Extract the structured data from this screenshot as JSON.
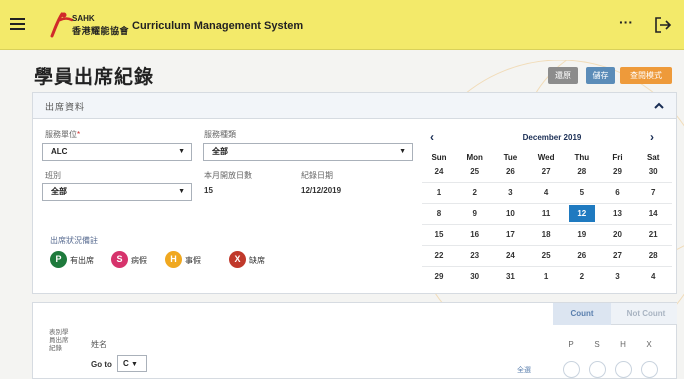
{
  "app": {
    "title": "Curriculum Management System",
    "logo_abbr": "SAHK",
    "logo_cn": "香港耀能協會",
    "more_label": "···"
  },
  "page": {
    "title": "學員出席紀錄",
    "actions": {
      "cancel": "還原",
      "save": "儲存",
      "view": "查閱模式"
    }
  },
  "attendance": {
    "panel_title": "出席資料",
    "service_unit": {
      "label": "服務單位",
      "required_mark": "*",
      "value": "ALC"
    },
    "service_type": {
      "label": "服務種類",
      "value": "全部"
    },
    "class": {
      "label": "班別",
      "value": "全部"
    },
    "open_days": {
      "label": "本月開放日數",
      "value": "15"
    },
    "record_date": {
      "label": "紀錄日期",
      "value": "12/12/2019"
    },
    "legend": {
      "title": "出席狀況備註",
      "items": [
        {
          "letter": "P",
          "label": "有出席",
          "color": "#1e7a3c"
        },
        {
          "letter": "S",
          "label": "病假",
          "color": "#d6336c"
        },
        {
          "letter": "H",
          "label": "事假",
          "color": "#f0a820"
        },
        {
          "letter": "X",
          "label": "缺席",
          "color": "#c0392b"
        }
      ]
    }
  },
  "calendar": {
    "month_label": "December 2019",
    "weekdays": [
      "Sun",
      "Mon",
      "Tue",
      "Wed",
      "Thu",
      "Fri",
      "Sat"
    ],
    "weeks": [
      [
        "24",
        "25",
        "26",
        "27",
        "28",
        "29",
        "30"
      ],
      [
        "1",
        "2",
        "3",
        "4",
        "5",
        "6",
        "7"
      ],
      [
        "8",
        "9",
        "10",
        "11",
        "12",
        "13",
        "14"
      ],
      [
        "15",
        "16",
        "17",
        "18",
        "19",
        "20",
        "21"
      ],
      [
        "22",
        "23",
        "24",
        "25",
        "26",
        "27",
        "28"
      ],
      [
        "29",
        "30",
        "31",
        "1",
        "2",
        "3",
        "4"
      ]
    ],
    "selected_day": "12"
  },
  "roster": {
    "left_label": "表別學員出席紀錄",
    "name_header": "姓名",
    "goto_label": "Go to",
    "goto_value": "C",
    "count_tab": "Count",
    "not_count_tab": "Not Count",
    "status_letters": [
      "P",
      "S",
      "H",
      "X"
    ],
    "select_all": "全選"
  }
}
